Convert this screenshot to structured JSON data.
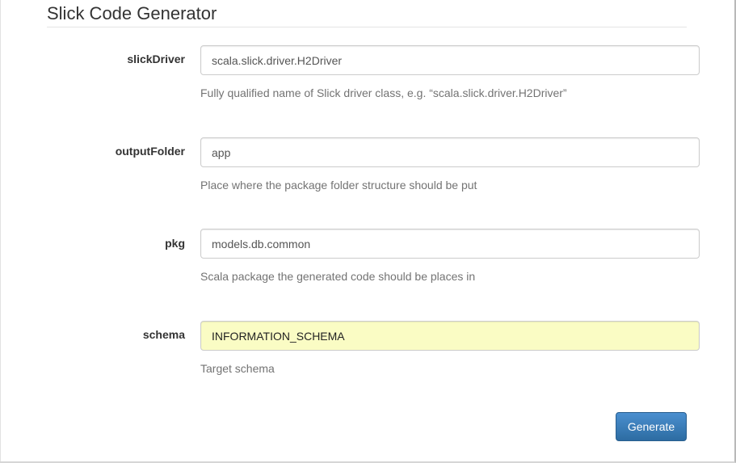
{
  "header": {
    "title": "Slick Code Generator"
  },
  "form": {
    "fields": [
      {
        "label": "slickDriver",
        "value": "scala.slick.driver.H2Driver",
        "help": "Fully qualified name of Slick driver class, e.g. “scala.slick.driver.H2Driver”"
      },
      {
        "label": "outputFolder",
        "value": "app",
        "help": "Place where the package folder structure should be put"
      },
      {
        "label": "pkg",
        "value": "models.db.common",
        "help": "Scala package the generated code should be places in"
      },
      {
        "label": "schema",
        "value": "INFORMATION_SCHEMA",
        "help": "Target schema",
        "autofilled": true
      }
    ],
    "submit_label": "Generate"
  },
  "colors": {
    "primary_button": "#3071a9",
    "autofill_background": "#fafcc4",
    "help_text": "#737373"
  }
}
